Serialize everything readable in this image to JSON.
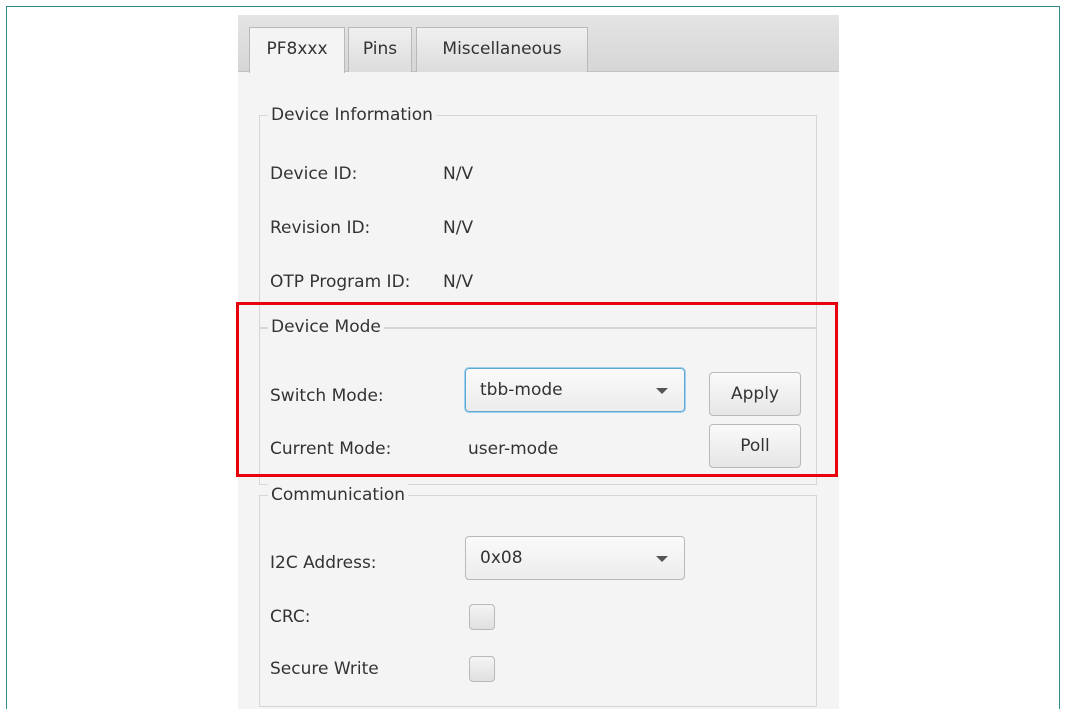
{
  "tabs": [
    {
      "label": "PF8xxx",
      "active": true
    },
    {
      "label": "Pins",
      "active": false
    },
    {
      "label": "Miscellaneous",
      "active": false
    }
  ],
  "device_information": {
    "legend": "Device Information",
    "device_id_label": "Device ID:",
    "device_id_value": "N/V",
    "revision_id_label": "Revision ID:",
    "revision_id_value": "N/V",
    "otp_program_id_label": "OTP Program ID:",
    "otp_program_id_value": "N/V"
  },
  "device_mode": {
    "legend": "Device Mode",
    "switch_mode_label": "Switch Mode:",
    "switch_mode_selected": "tbb-mode",
    "apply_label": "Apply",
    "current_mode_label": "Current Mode:",
    "current_mode_value": "user-mode",
    "poll_label": "Poll"
  },
  "communication": {
    "legend": "Communication",
    "i2c_address_label": "I2C Address:",
    "i2c_address_selected": "0x08",
    "crc_label": "CRC:",
    "crc_checked": false,
    "secure_write_label": "Secure Write",
    "secure_write_checked": false
  },
  "colors": {
    "highlight_border": "#e8000d",
    "focus_border": "#5fa8d3",
    "frame_border": "#2e8a8a"
  },
  "icons": {
    "dropdown_caret": "chevron-down-icon"
  }
}
